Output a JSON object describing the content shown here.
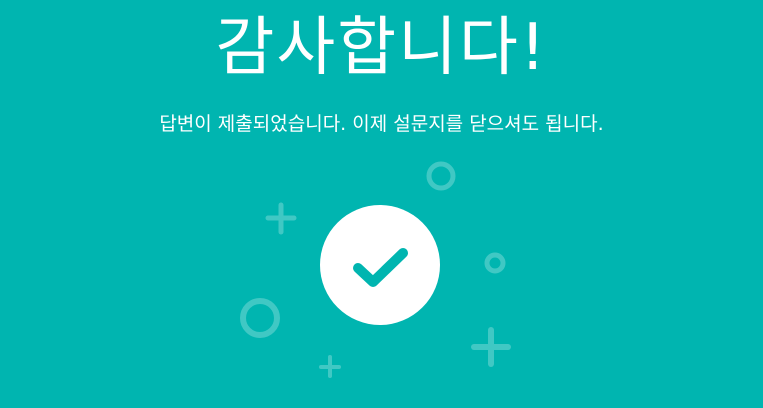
{
  "page": {
    "title": "감사합니다!",
    "message": "답변이 제출되었습니다. 이제 설문지를 닫으셔도 됩니다."
  },
  "colors": {
    "background": "#00b5b0",
    "foreground": "#ffffff",
    "decoration": "#3fc7c3"
  },
  "icons": {
    "success": "check-circle-icon",
    "decorations": [
      "plus-icon",
      "ring-icon"
    ]
  }
}
